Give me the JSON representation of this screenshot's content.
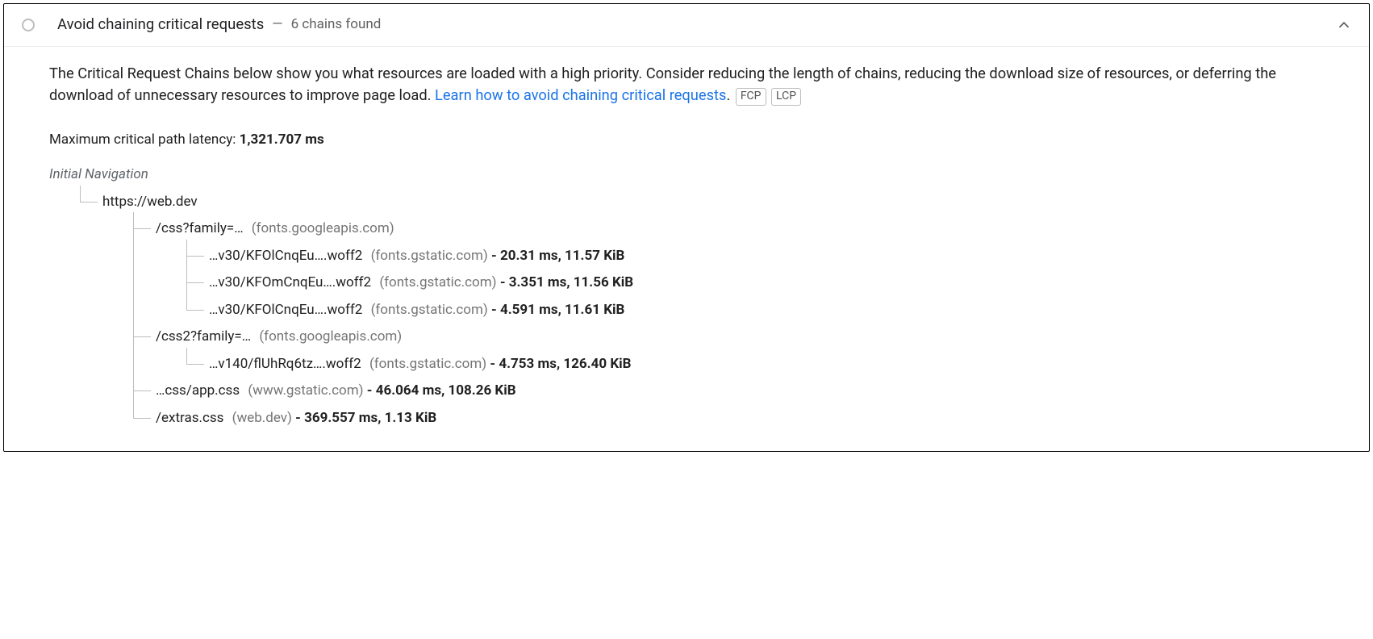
{
  "header": {
    "title": "Avoid chaining critical requests",
    "subText": "6 chains found"
  },
  "description": {
    "pre": "The Critical Request Chains below show you what resources are loaded with a high priority. Consider reducing the length of chains, reducing the download size of resources, or deferring the download of unnecessary resources to improve page load. ",
    "linkText": "Learn how to avoid chaining critical requests",
    "post": "."
  },
  "tags": {
    "fcp": "FCP",
    "lcp": "LCP"
  },
  "latency": {
    "label": "Maximum critical path latency: ",
    "value": "1,321.707 ms"
  },
  "tree": {
    "rootLabel": "Initial Navigation",
    "nodes": {
      "n0": {
        "url": "https://web.dev"
      },
      "n1": {
        "url": "/css?family=…",
        "host": "(fonts.googleapis.com)"
      },
      "n1a": {
        "url": "…v30/KFOlCnqEu….woff2",
        "host": "(fonts.gstatic.com)",
        "metric": "20.31 ms, 11.57 KiB"
      },
      "n1b": {
        "url": "…v30/KFOmCnqEu….woff2",
        "host": "(fonts.gstatic.com)",
        "metric": "3.351 ms, 11.56 KiB"
      },
      "n1c": {
        "url": "…v30/KFOlCnqEu….woff2",
        "host": "(fonts.gstatic.com)",
        "metric": "4.591 ms, 11.61 KiB"
      },
      "n2": {
        "url": "/css2?family=…",
        "host": "(fonts.googleapis.com)"
      },
      "n2a": {
        "url": "…v140/flUhRq6tz….woff2",
        "host": "(fonts.gstatic.com)",
        "metric": "4.753 ms, 126.40 KiB"
      },
      "n3": {
        "url": "…css/app.css",
        "host": "(www.gstatic.com)",
        "metric": "46.064 ms, 108.26 KiB"
      },
      "n4": {
        "url": "/extras.css",
        "host": "(web.dev)",
        "metric": "369.557 ms, 1.13 KiB"
      }
    }
  }
}
